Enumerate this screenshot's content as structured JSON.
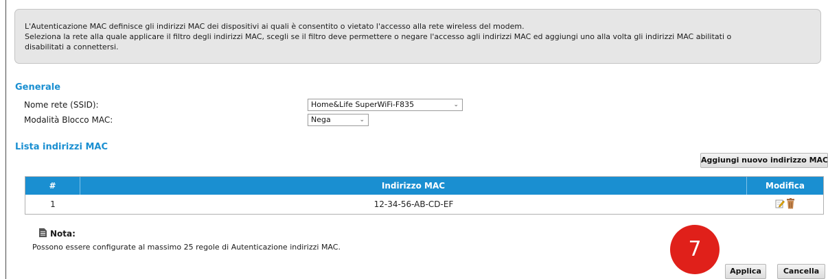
{
  "info": {
    "line1": "L'Autenticazione MAC definisce gli indirizzi MAC dei dispositivi ai quali è consentito o vietato l'accesso alla rete wireless del modem.",
    "line2": "Seleziona la rete alla quale applicare il filtro degli indirizzi MAC, scegli se il filtro deve permettere o negare l'accesso agli indirizzi MAC ed aggiungi uno alla volta gli indirizzi MAC abilitati o",
    "line3": "disabilitati a connettersi."
  },
  "general": {
    "title": "Generale",
    "ssid_label": "Nome rete (SSID):",
    "ssid_value": "Home&Life SuperWiFi-F835",
    "mode_label": "Modalità Blocco MAC:",
    "mode_value": "Nega"
  },
  "mac_list": {
    "title": "Lista indirizzi MAC",
    "add_button": "Aggiungi nuovo indirizzo MAC",
    "columns": [
      "#",
      "Indirizzo MAC",
      "Modifica"
    ],
    "rows": [
      {
        "index": "1",
        "mac": "12-34-56-AB-CD-EF"
      }
    ]
  },
  "note": {
    "title": "Nota:",
    "text": "Possono essere configurate al massimo 25 regole di Autenticazione indirizzi MAC."
  },
  "step_badge": "7",
  "actions": {
    "apply": "Applica",
    "cancel": "Cancella"
  },
  "colors": {
    "accent": "#1a8fd1",
    "badge": "#e0201a"
  }
}
